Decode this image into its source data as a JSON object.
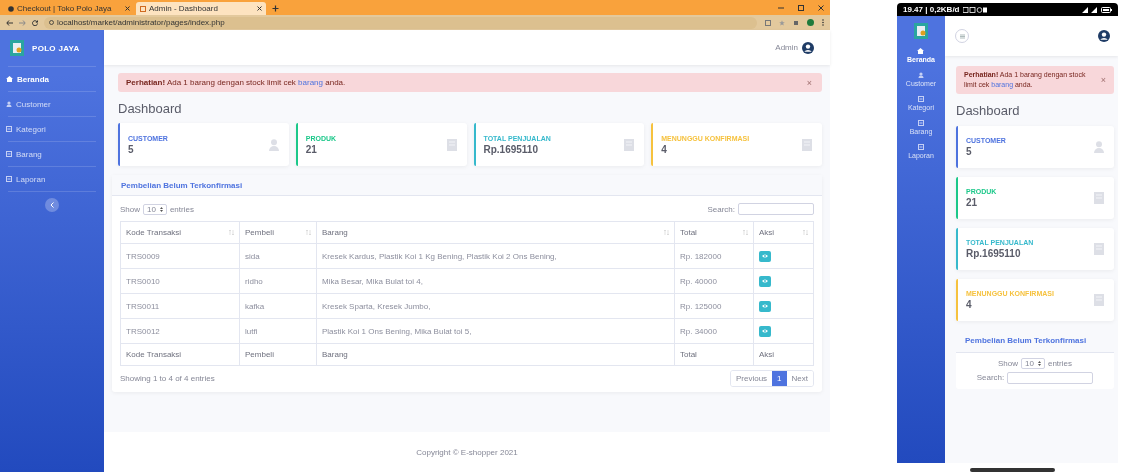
{
  "desktop": {
    "browser": {
      "tabs": [
        {
          "title": "Checkout | Toko Polo Jaya",
          "selected": false
        },
        {
          "title": "Admin - Dashboard",
          "selected": true
        }
      ],
      "url": "localhost/market/administrator/pages/index.php"
    },
    "sidebar": {
      "brand": "POLO JAYA",
      "items": [
        {
          "label": "Beranda",
          "selected": true
        },
        {
          "label": "Customer",
          "selected": false
        },
        {
          "label": "Kategori",
          "selected": false
        },
        {
          "label": "Barang",
          "selected": false
        },
        {
          "label": "Laporan",
          "selected": false
        }
      ]
    },
    "topbar": {
      "user": "Admin"
    },
    "alert": {
      "lead": "Perhatian!",
      "before": "Ada 1 barang dengan stock limit cek",
      "link": "barang",
      "after": "anda.",
      "close": "×"
    },
    "heading": "Dashboard",
    "cards": [
      {
        "label": "CUSTOMER",
        "value": "5",
        "color": "#4e73df"
      },
      {
        "label": "PRODUK",
        "value": "21",
        "color": "#1cc88a"
      },
      {
        "label": "TOTAL PENJUALAN",
        "value": "Rp.1695110",
        "color": "#36b9cc"
      },
      {
        "label": "MENUNGGU KONFIRMASI",
        "value": "4",
        "color": "#f6c23e"
      }
    ],
    "table_card": {
      "title": "Pembelian Belum Terkonfirmasi",
      "show": "Show",
      "length": "10",
      "entries": "entries",
      "search": "Search:",
      "columns": [
        "Kode Transaksi",
        "Pembeli",
        "Barang",
        "Total",
        "Aksi"
      ],
      "rows": [
        {
          "cells": [
            "TRS0009",
            "sida",
            "Kresek Kardus, Plastik Koi 1 Kg Bening, Plastik Koi 2 Ons Bening,",
            "Rp. 182000"
          ]
        },
        {
          "cells": [
            "TRS0010",
            "ridho",
            "Mika Besar, Mika Bulat toi 4,",
            "Rp. 40000"
          ]
        },
        {
          "cells": [
            "TRS0011",
            "kafka",
            "Kresek Sparta, Kresek Jumbo,",
            "Rp. 125000"
          ]
        },
        {
          "cells": [
            "TRS0012",
            "lutfi",
            "Plastik Koi 1 Ons Bening, Mika Bulat toi 5,",
            "Rp. 34000"
          ]
        }
      ],
      "footer_columns": [
        "Kode Transaksi",
        "Pembeli",
        "Barang",
        "Total",
        "Aksi"
      ],
      "info": "Showing 1 to 4 of 4 entries",
      "pages": [
        {
          "label": "Previous",
          "selected": false
        },
        {
          "label": "1",
          "selected": true
        },
        {
          "label": "Next",
          "selected": false
        }
      ]
    },
    "footer": "Copyright © E-shopper 2021"
  },
  "mobile": {
    "status_bar": {
      "text": "19.47 | 0,2KB/d"
    },
    "sidebar": {
      "items": [
        {
          "label": "Beranda",
          "selected": true
        },
        {
          "label": "Customer",
          "selected": false
        },
        {
          "label": "Kategori",
          "selected": false
        },
        {
          "label": "Barang",
          "selected": false
        },
        {
          "label": "Laporan",
          "selected": false
        }
      ]
    },
    "alert": {
      "lead": "Perhatian!",
      "before": "Ada 1 barang dengan stock limit cek",
      "link": "barang",
      "after": "anda.",
      "close": "×"
    },
    "heading": "Dashboard",
    "cards": [
      {
        "label": "CUSTOMER",
        "value": "5",
        "color": "#4e73df"
      },
      {
        "label": "PRODUK",
        "value": "21",
        "color": "#1cc88a"
      },
      {
        "label": "TOTAL PENJUALAN",
        "value": "Rp.1695110",
        "color": "#36b9cc"
      },
      {
        "label": "MENUNGGU KONFIRMASI",
        "value": "4",
        "color": "#f6c23e"
      }
    ],
    "table_card": {
      "title": "Pembelian Belum Terkonfirmasi",
      "show": "Show",
      "length": "10",
      "entries": "entries",
      "search": "Search:"
    }
  }
}
